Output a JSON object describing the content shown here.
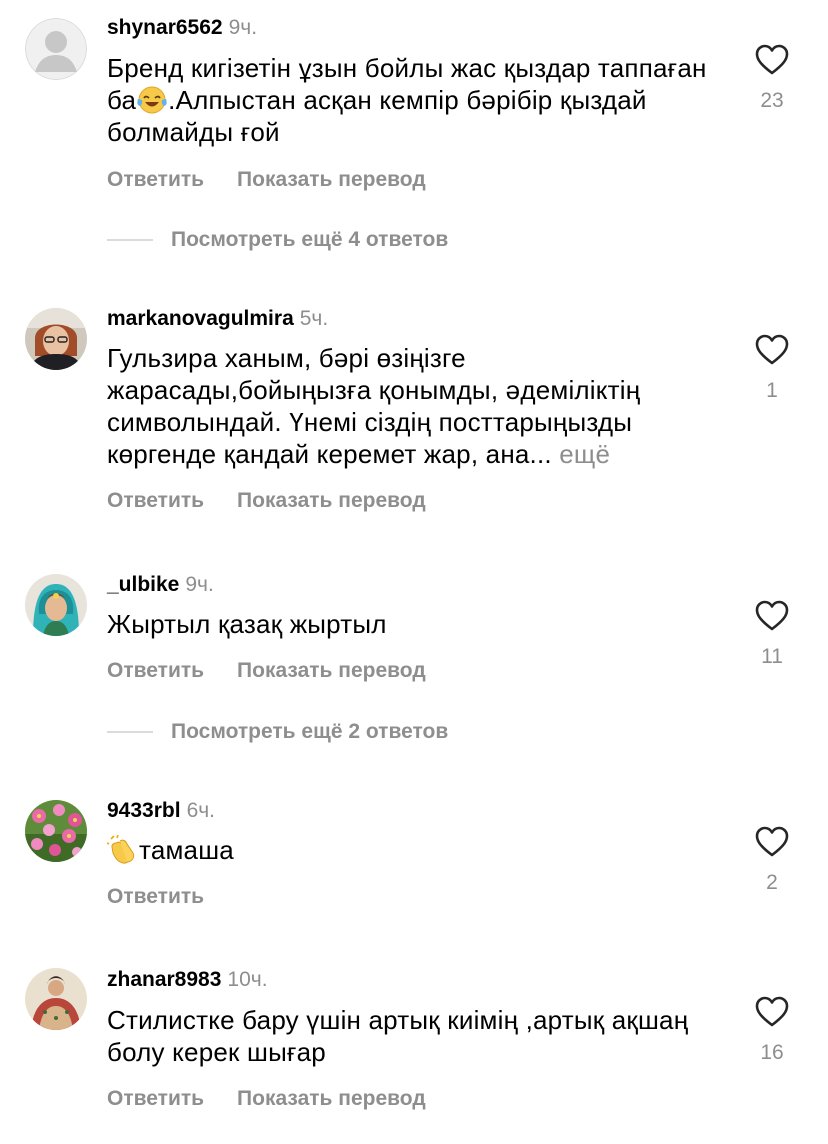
{
  "ui": {
    "reply_label": "Ответить",
    "translate_label": "Показать перевод"
  },
  "comments": [
    {
      "username": "shynar6562",
      "time": "9ч.",
      "text_before_emoji": "Бренд кигізетін ұзын бойлы жас қыздар таппаған ба",
      "emoji": "face-with-tears-of-joy-emoji",
      "text_after_emoji": ".Алпыстан асқан кемпір бәрібір қыздай болмайды ғой",
      "likes": "23",
      "view_replies": "Посмотреть ещё 4 ответов"
    },
    {
      "username": "markanovagulmira",
      "time": "5ч.",
      "text": "Гульзира  ханым, бәрі өзіңізге жарасады,бойыңызға қонымды, әдеміліктің символындай. Үнемі сіздің посттарыңызды көргенде қандай керемет жар, ана...",
      "more_label": "ещё",
      "likes": "1"
    },
    {
      "username": "_ulbike",
      "time": "9ч.",
      "text": "Жыртыл қазақ жыртыл",
      "likes": "11",
      "view_replies": "Посмотреть ещё 2 ответов"
    },
    {
      "username": "9433rbl",
      "time": "6ч.",
      "emoji": "clapping-hands-emoji",
      "text": "тамаша",
      "likes": "2"
    },
    {
      "username": "zhanar8983",
      "time": "10ч.",
      "text": "Стилистке бару үшін артық киімің ,артық ақшаң болу керек шығар",
      "likes": "16"
    }
  ],
  "icons": {
    "like": "heart-outline-icon"
  },
  "colors": {
    "text": "#000000",
    "secondary": "#8e8e8e",
    "divider": "#dbdbdb",
    "background": "#ffffff"
  }
}
